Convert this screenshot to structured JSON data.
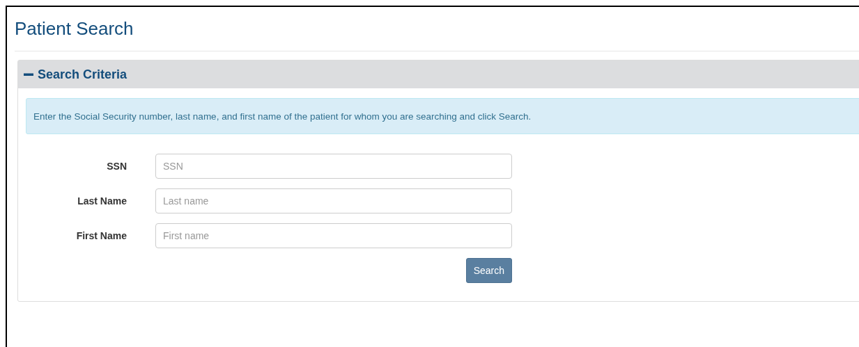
{
  "page": {
    "title": "Patient Search"
  },
  "panel": {
    "title": "Search Criteria",
    "expanded": true,
    "info": "Enter the Social Security number, last name, and first name of the patient for whom you are searching and click Search.",
    "fields": [
      {
        "label": "SSN",
        "placeholder": "SSN"
      },
      {
        "label": "Last Name",
        "placeholder": "Last name"
      },
      {
        "label": "First Name",
        "placeholder": "First name"
      }
    ],
    "button": "Search"
  }
}
